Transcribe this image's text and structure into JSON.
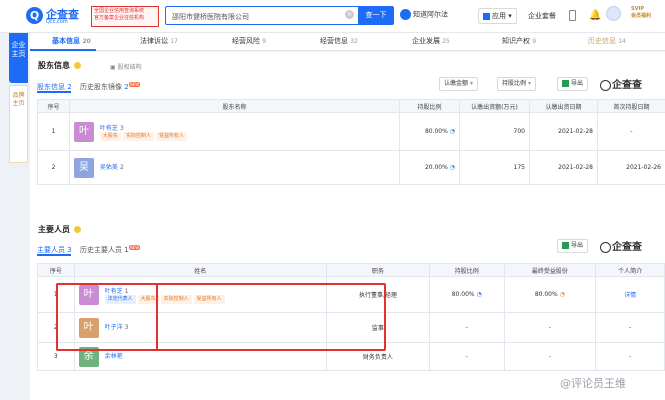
{
  "header": {
    "logo_text": "企查查",
    "logo_sub": "Qcc.com",
    "promo_lines": [
      "全国企业信用查询系统",
      "官方备案企业征信机构"
    ],
    "search_value": "邵阳市健桥医院有限公司",
    "search_button": "查一下",
    "zhidao": "知道阿尔法",
    "apps": "应用",
    "qiye": "企业套餐",
    "svip_lines": [
      "SVIP",
      "会员福利"
    ]
  },
  "sidenav": {
    "primary": "企业主页",
    "secondary": "品牌主页"
  },
  "tabs": [
    {
      "label": "基本信息",
      "count": "20"
    },
    {
      "label": "法律诉讼",
      "count": "17"
    },
    {
      "label": "经营风险",
      "count": "9"
    },
    {
      "label": "经营信息",
      "count": "32"
    },
    {
      "label": "企业发展",
      "count": "25"
    },
    {
      "label": "知识产权",
      "count": "9"
    },
    {
      "label": "历史信息",
      "count": "14"
    }
  ],
  "shareholders": {
    "title": "股东信息",
    "struct_link": "股权结构",
    "subtab_active": "股东信息 2",
    "subtab_other": "历史股东镜像",
    "subtab_other_count": "2",
    "new_badge": "NEW",
    "filter1": "认缴金额",
    "filter2": "持股比例",
    "export": "导出",
    "brand": "企查查",
    "columns": [
      "序号",
      "股东名称",
      "持股比例",
      "认缴出资额(万元)",
      "认缴出资日期",
      "首次持股日期"
    ],
    "rows": [
      {
        "idx": "1",
        "avatar": "叶",
        "avatar_color": "#c98bd1",
        "name": "叶有芝",
        "count": "3",
        "tags": [
          "大股东",
          "实际控制人",
          "受益所有人"
        ],
        "ratio": "80.00%",
        "amount": "700",
        "date": "2021-02-28",
        "first": "-"
      },
      {
        "idx": "2",
        "avatar": "吴",
        "avatar_color": "#8da4e0",
        "name": "吴佑美",
        "count": "2",
        "tags": [],
        "ratio": "20.00%",
        "amount": "175",
        "date": "2021-02-28",
        "first": "2021-02-26"
      }
    ]
  },
  "staff": {
    "title": "主要人员",
    "subtab_active": "主要人员 3",
    "subtab_other": "历史主要人员 1",
    "new_badge": "NEW",
    "export": "导出",
    "brand": "企查查",
    "columns": [
      "序号",
      "姓名",
      "职务",
      "持股比例",
      "最终受益股份",
      "个人简介"
    ],
    "rows": [
      {
        "idx": "1",
        "avatar": "叶",
        "avatar_color": "#c98bd1",
        "name": "叶有芝",
        "count": "1",
        "tags": [
          "法定代表人",
          "大股东",
          "实际控制人",
          "受益所有人"
        ],
        "role": "执行董事,经理",
        "ratio": "80.00%",
        "benefit": "80.00%",
        "intro": "详情"
      },
      {
        "idx": "2",
        "avatar": "叶",
        "avatar_color": "#d9a06b",
        "name": "叶子洋",
        "count": "3",
        "tags": [],
        "role": "监事",
        "ratio": "-",
        "benefit": "-",
        "intro": "-"
      },
      {
        "idx": "3",
        "avatar": "余",
        "avatar_color": "#6fb27d",
        "name": "余林艳",
        "count": "",
        "tags": [],
        "role": "财务负责人",
        "ratio": "-",
        "benefit": "-",
        "intro": "-"
      }
    ]
  },
  "watermark": "@评论员王维"
}
